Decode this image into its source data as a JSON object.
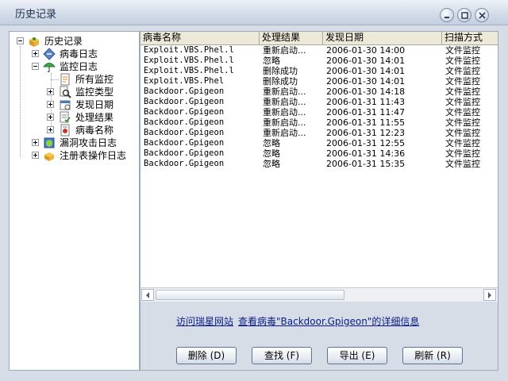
{
  "window": {
    "title": "历史记录"
  },
  "tree": {
    "root": "历史记录",
    "items": [
      {
        "label": "病毒日志"
      },
      {
        "label": "监控日志"
      },
      {
        "label": "所有监控"
      },
      {
        "label": "监控类型"
      },
      {
        "label": "发现日期"
      },
      {
        "label": "处理结果"
      },
      {
        "label": "病毒名称"
      },
      {
        "label": "漏洞攻击日志"
      },
      {
        "label": "注册表操作日志"
      }
    ]
  },
  "table": {
    "columns": [
      "病毒名称",
      "处理结果",
      "发现日期",
      "扫描方式"
    ],
    "rows": [
      [
        "Exploit.VBS.Phel.l",
        "重新启动...",
        "2006-01-30  14:00",
        "文件监控"
      ],
      [
        "Exploit.VBS.Phel.l",
        "忽略",
        "2006-01-30  14:01",
        "文件监控"
      ],
      [
        "Exploit.VBS.Phel.l",
        "删除成功",
        "2006-01-30  14:01",
        "文件监控"
      ],
      [
        "Exploit.VBS.Phel",
        "删除成功",
        "2006-01-30  14:01",
        "文件监控"
      ],
      [
        "Backdoor.Gpigeon",
        "重新启动...",
        "2006-01-30  14:18",
        "文件监控"
      ],
      [
        "Backdoor.Gpigeon",
        "重新启动...",
        "2006-01-31  11:43",
        "文件监控"
      ],
      [
        "Backdoor.Gpigeon",
        "重新启动...",
        "2006-01-31  11:47",
        "文件监控"
      ],
      [
        "Backdoor.Gpigeon",
        "重新启动...",
        "2006-01-31  11:55",
        "文件监控"
      ],
      [
        "Backdoor.Gpigeon",
        "重新启动...",
        "2006-01-31  12:23",
        "文件监控"
      ],
      [
        "Backdoor.Gpigeon",
        "忽略",
        "2006-01-31  12:55",
        "文件监控"
      ],
      [
        "Backdoor.Gpigeon",
        "忽略",
        "2006-01-31  14:36",
        "文件监控"
      ],
      [
        "Backdoor.Gpigeon",
        "忽略",
        "2006-01-31  15:35",
        "文件监控"
      ]
    ]
  },
  "links": {
    "visit_site": "访问瑞星网站",
    "virus_info": "查看病毒\"Backdoor.Gpigeon\"的详细信息"
  },
  "buttons": {
    "delete": "删除 (D)",
    "find": "查找 (F)",
    "export": "导出 (E)",
    "refresh": "刷新 (R)"
  },
  "colors": {
    "window_bg": "#d6dde6",
    "link": "#0a1a8c"
  }
}
